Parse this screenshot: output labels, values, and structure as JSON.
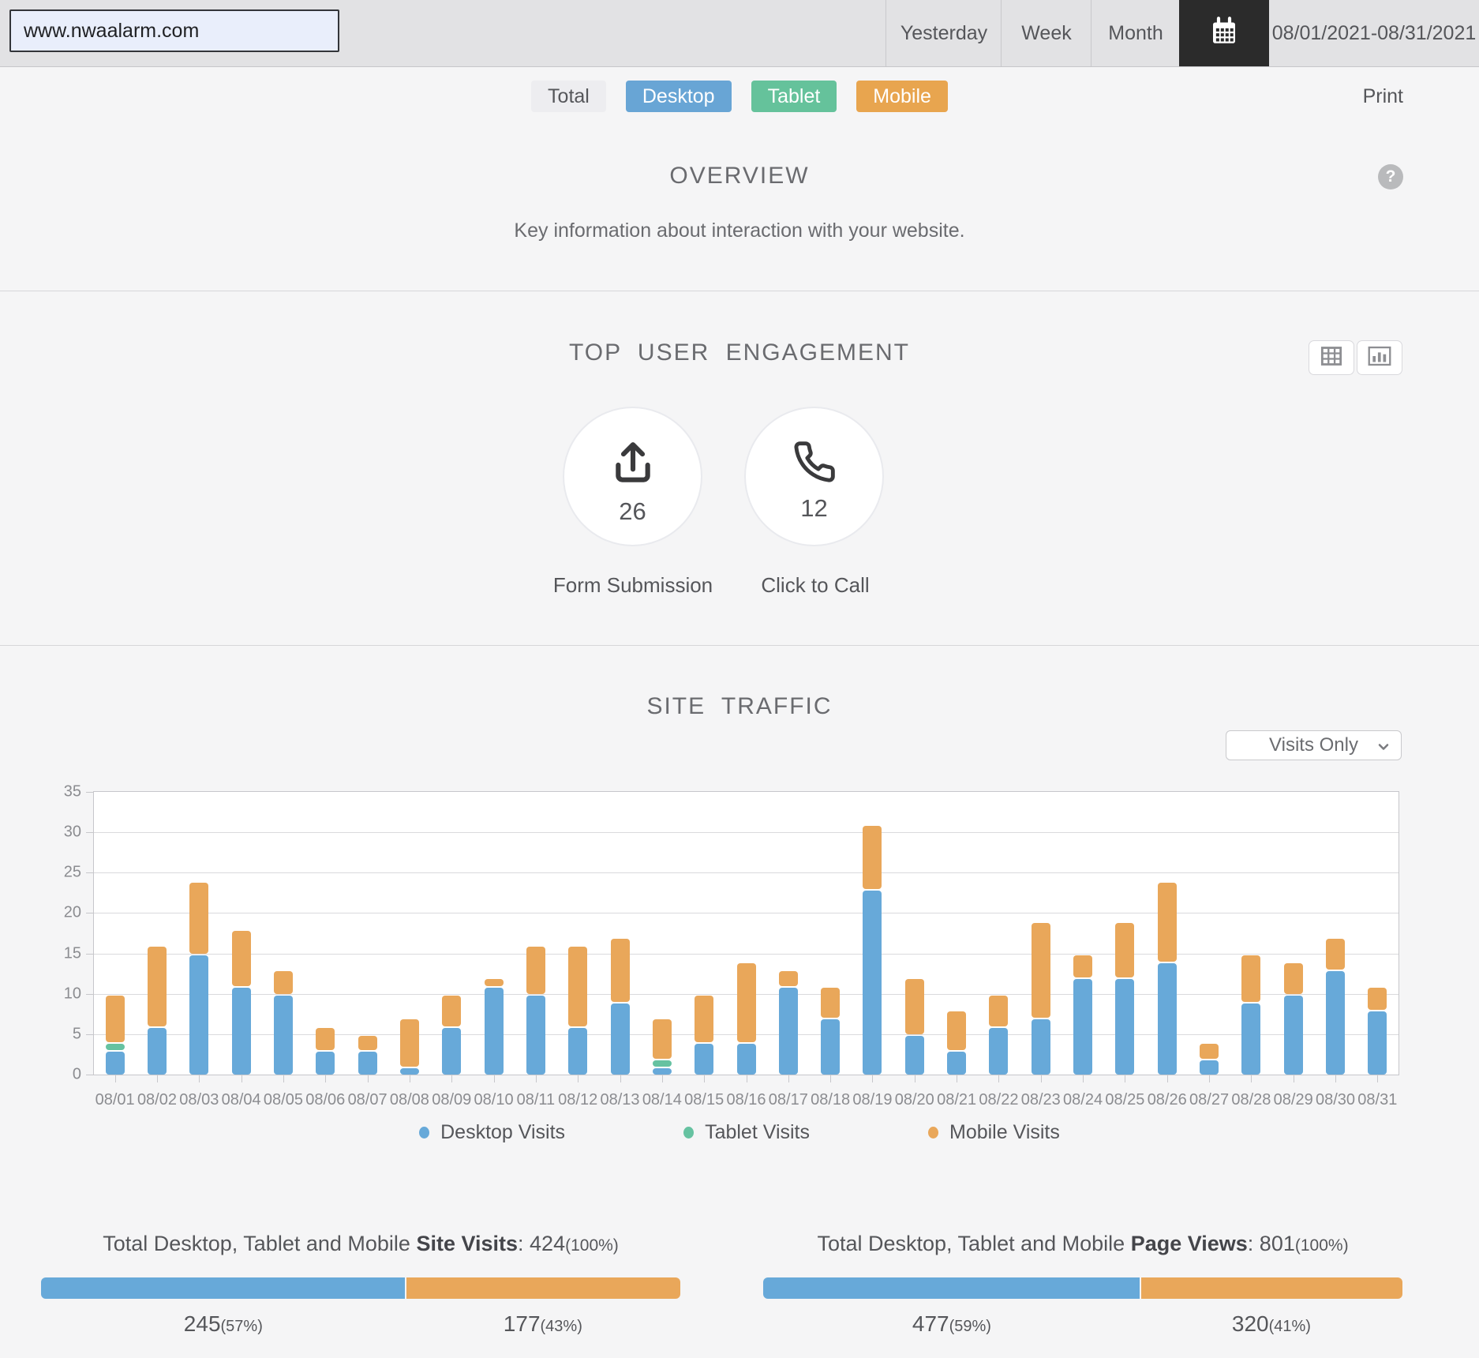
{
  "topbar": {
    "url": "www.nwaalarm.com",
    "tabs": [
      {
        "label": "Yesterday"
      },
      {
        "label": "Week"
      },
      {
        "label": "Month"
      }
    ],
    "date_range": "08/01/2021-08/31/2021"
  },
  "filters": {
    "buttons": [
      {
        "label": "Total",
        "bg": "#ededf0",
        "fg": "#55565a"
      },
      {
        "label": "Desktop",
        "bg": "#68a5d5",
        "fg": "#ffffff"
      },
      {
        "label": "Tablet",
        "bg": "#65c29b",
        "fg": "#ffffff"
      },
      {
        "label": "Mobile",
        "bg": "#e8a54f",
        "fg": "#ffffff"
      }
    ],
    "print": "Print"
  },
  "overview": {
    "title": "OVERVIEW",
    "subtitle": "Key information about interaction with your website.",
    "help": "?"
  },
  "engagement": {
    "title": "TOP USER ENGAGEMENT",
    "items": [
      {
        "label": "Form Submission",
        "value": "26"
      },
      {
        "label": "Click to Call",
        "value": "12"
      }
    ]
  },
  "site_traffic": {
    "title": "SITE TRAFFIC",
    "dropdown": "Visits Only"
  },
  "chart_data": {
    "type": "bar",
    "stacked": true,
    "title": "SITE TRAFFIC",
    "xlabel": "",
    "ylabel": "",
    "ylim": [
      0,
      35
    ],
    "yticks": [
      0,
      5,
      10,
      15,
      20,
      25,
      30,
      35
    ],
    "grid": true,
    "legend_position": "bottom",
    "categories": [
      "08/01",
      "08/02",
      "08/03",
      "08/04",
      "08/05",
      "08/06",
      "08/07",
      "08/08",
      "08/09",
      "08/10",
      "08/11",
      "08/12",
      "08/13",
      "08/14",
      "08/15",
      "08/16",
      "08/17",
      "08/18",
      "08/19",
      "08/20",
      "08/21",
      "08/22",
      "08/23",
      "08/24",
      "08/25",
      "08/26",
      "08/27",
      "08/28",
      "08/29",
      "08/30",
      "08/31"
    ],
    "series": [
      {
        "name": "Desktop Visits",
        "color": "#67a9d9",
        "values": [
          3,
          6,
          15,
          11,
          10,
          3,
          3,
          1,
          6,
          11,
          10,
          6,
          9,
          1,
          4,
          4,
          11,
          7,
          23,
          5,
          3,
          6,
          7,
          12,
          12,
          14,
          2,
          9,
          10,
          13,
          8
        ]
      },
      {
        "name": "Tablet Visits",
        "color": "#66c2a1",
        "values": [
          1,
          0,
          0,
          0,
          0,
          0,
          0,
          0,
          0,
          0,
          0,
          0,
          0,
          1,
          0,
          0,
          0,
          0,
          0,
          0,
          0,
          0,
          0,
          0,
          0,
          0,
          0,
          0,
          0,
          0,
          0
        ]
      },
      {
        "name": "Mobile Visits",
        "color": "#e9a75a",
        "values": [
          6,
          10,
          9,
          7,
          3,
          3,
          2,
          6,
          4,
          1,
          6,
          10,
          8,
          5,
          6,
          10,
          2,
          4,
          8,
          7,
          5,
          4,
          12,
          3,
          7,
          10,
          2,
          6,
          4,
          4,
          3
        ]
      }
    ]
  },
  "legend": [
    {
      "label": "Desktop Visits",
      "color": "#67a9d9"
    },
    {
      "label": "Tablet Visits",
      "color": "#66c2a1"
    },
    {
      "label": "Mobile Visits",
      "color": "#e9a75a"
    }
  ],
  "colon": ": ",
  "summaries": [
    {
      "title_prefix": "Total Desktop, Tablet and Mobile ",
      "title_bold": "Site Visits",
      "total": "424",
      "total_pct": "(100%)",
      "segments": [
        {
          "value": "245",
          "pct": "(57%)",
          "color": "#67a9d9",
          "width_pct": 57
        },
        {
          "value": "177",
          "pct": "(43%)",
          "color": "#e9a75a",
          "width_pct": 43
        }
      ]
    },
    {
      "title_prefix": "Total Desktop, Tablet and Mobile ",
      "title_bold": "Page Views",
      "total": "801",
      "total_pct": "(100%)",
      "segments": [
        {
          "value": "477",
          "pct": "(59%)",
          "color": "#67a9d9",
          "width_pct": 59
        },
        {
          "value": "320",
          "pct": "(41%)",
          "color": "#e9a75a",
          "width_pct": 41
        }
      ]
    }
  ]
}
